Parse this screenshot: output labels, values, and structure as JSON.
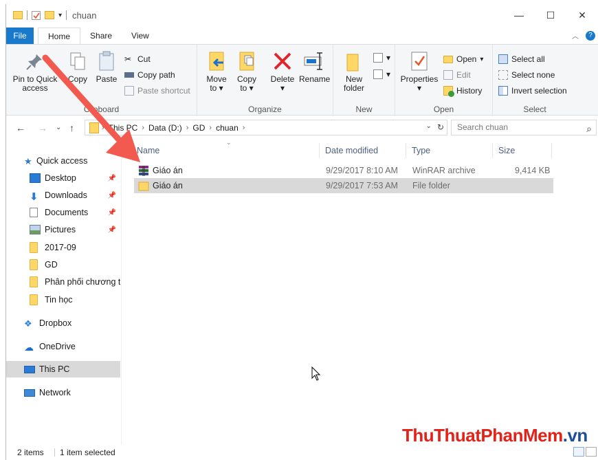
{
  "window": {
    "title": "chuan"
  },
  "tabs": [
    {
      "label": "File"
    },
    {
      "label": "Home"
    },
    {
      "label": "Share"
    },
    {
      "label": "View"
    }
  ],
  "ribbon": {
    "clipboard": {
      "label": "Clipboard",
      "pin_line1": "Pin to Quick",
      "pin_line2": "access",
      "copy": "Copy",
      "paste": "Paste",
      "cut": "Cut",
      "copy_path": "Copy path",
      "paste_shortcut": "Paste shortcut"
    },
    "organize": {
      "label": "Organize",
      "move_line1": "Move",
      "move_line2": "to",
      "copy_line1": "Copy",
      "copy_line2": "to",
      "delete": "Delete",
      "rename": "Rename"
    },
    "new": {
      "label": "New",
      "folder_line1": "New",
      "folder_line2": "folder"
    },
    "open": {
      "label": "Open",
      "properties": "Properties",
      "open": "Open",
      "edit": "Edit",
      "history": "History"
    },
    "select": {
      "label": "Select",
      "select_all": "Select all",
      "select_none": "Select none",
      "invert": "Invert selection"
    }
  },
  "address": {
    "crumbs": [
      "This PC",
      "Data (D:)",
      "GD",
      "chuan"
    ],
    "search_placeholder": "Search chuan"
  },
  "navpane": {
    "quick_access": "Quick access",
    "items": [
      {
        "label": "Desktop",
        "pinned": true
      },
      {
        "label": "Downloads",
        "pinned": true
      },
      {
        "label": "Documents",
        "pinned": true
      },
      {
        "label": "Pictures",
        "pinned": true
      },
      {
        "label": "2017-09",
        "pinned": false
      },
      {
        "label": "GD",
        "pinned": false
      },
      {
        "label": "Phân phối chương t",
        "pinned": false
      },
      {
        "label": "Tin học",
        "pinned": false
      }
    ],
    "dropbox": "Dropbox",
    "onedrive": "OneDrive",
    "thispc": "This PC",
    "network": "Network"
  },
  "columns": {
    "name": "Name",
    "date": "Date modified",
    "type": "Type",
    "size": "Size"
  },
  "files": [
    {
      "name": "Giáo án",
      "date": "9/29/2017 8:10 AM",
      "type": "WinRAR archive",
      "size": "9,414 KB",
      "icon": "winrar-icon"
    },
    {
      "name": "Giáo án",
      "date": "9/29/2017 7:53 AM",
      "type": "File folder",
      "size": "",
      "icon": "folder-icon"
    }
  ],
  "status": {
    "count": "2 items",
    "selected": "1 item selected"
  },
  "watermark": {
    "part1": "ThuThuat",
    "part2": "PhanMem",
    "part3": ".vn"
  },
  "colors": {
    "accent": "#1979ca",
    "arrow": "#f25a4f"
  }
}
